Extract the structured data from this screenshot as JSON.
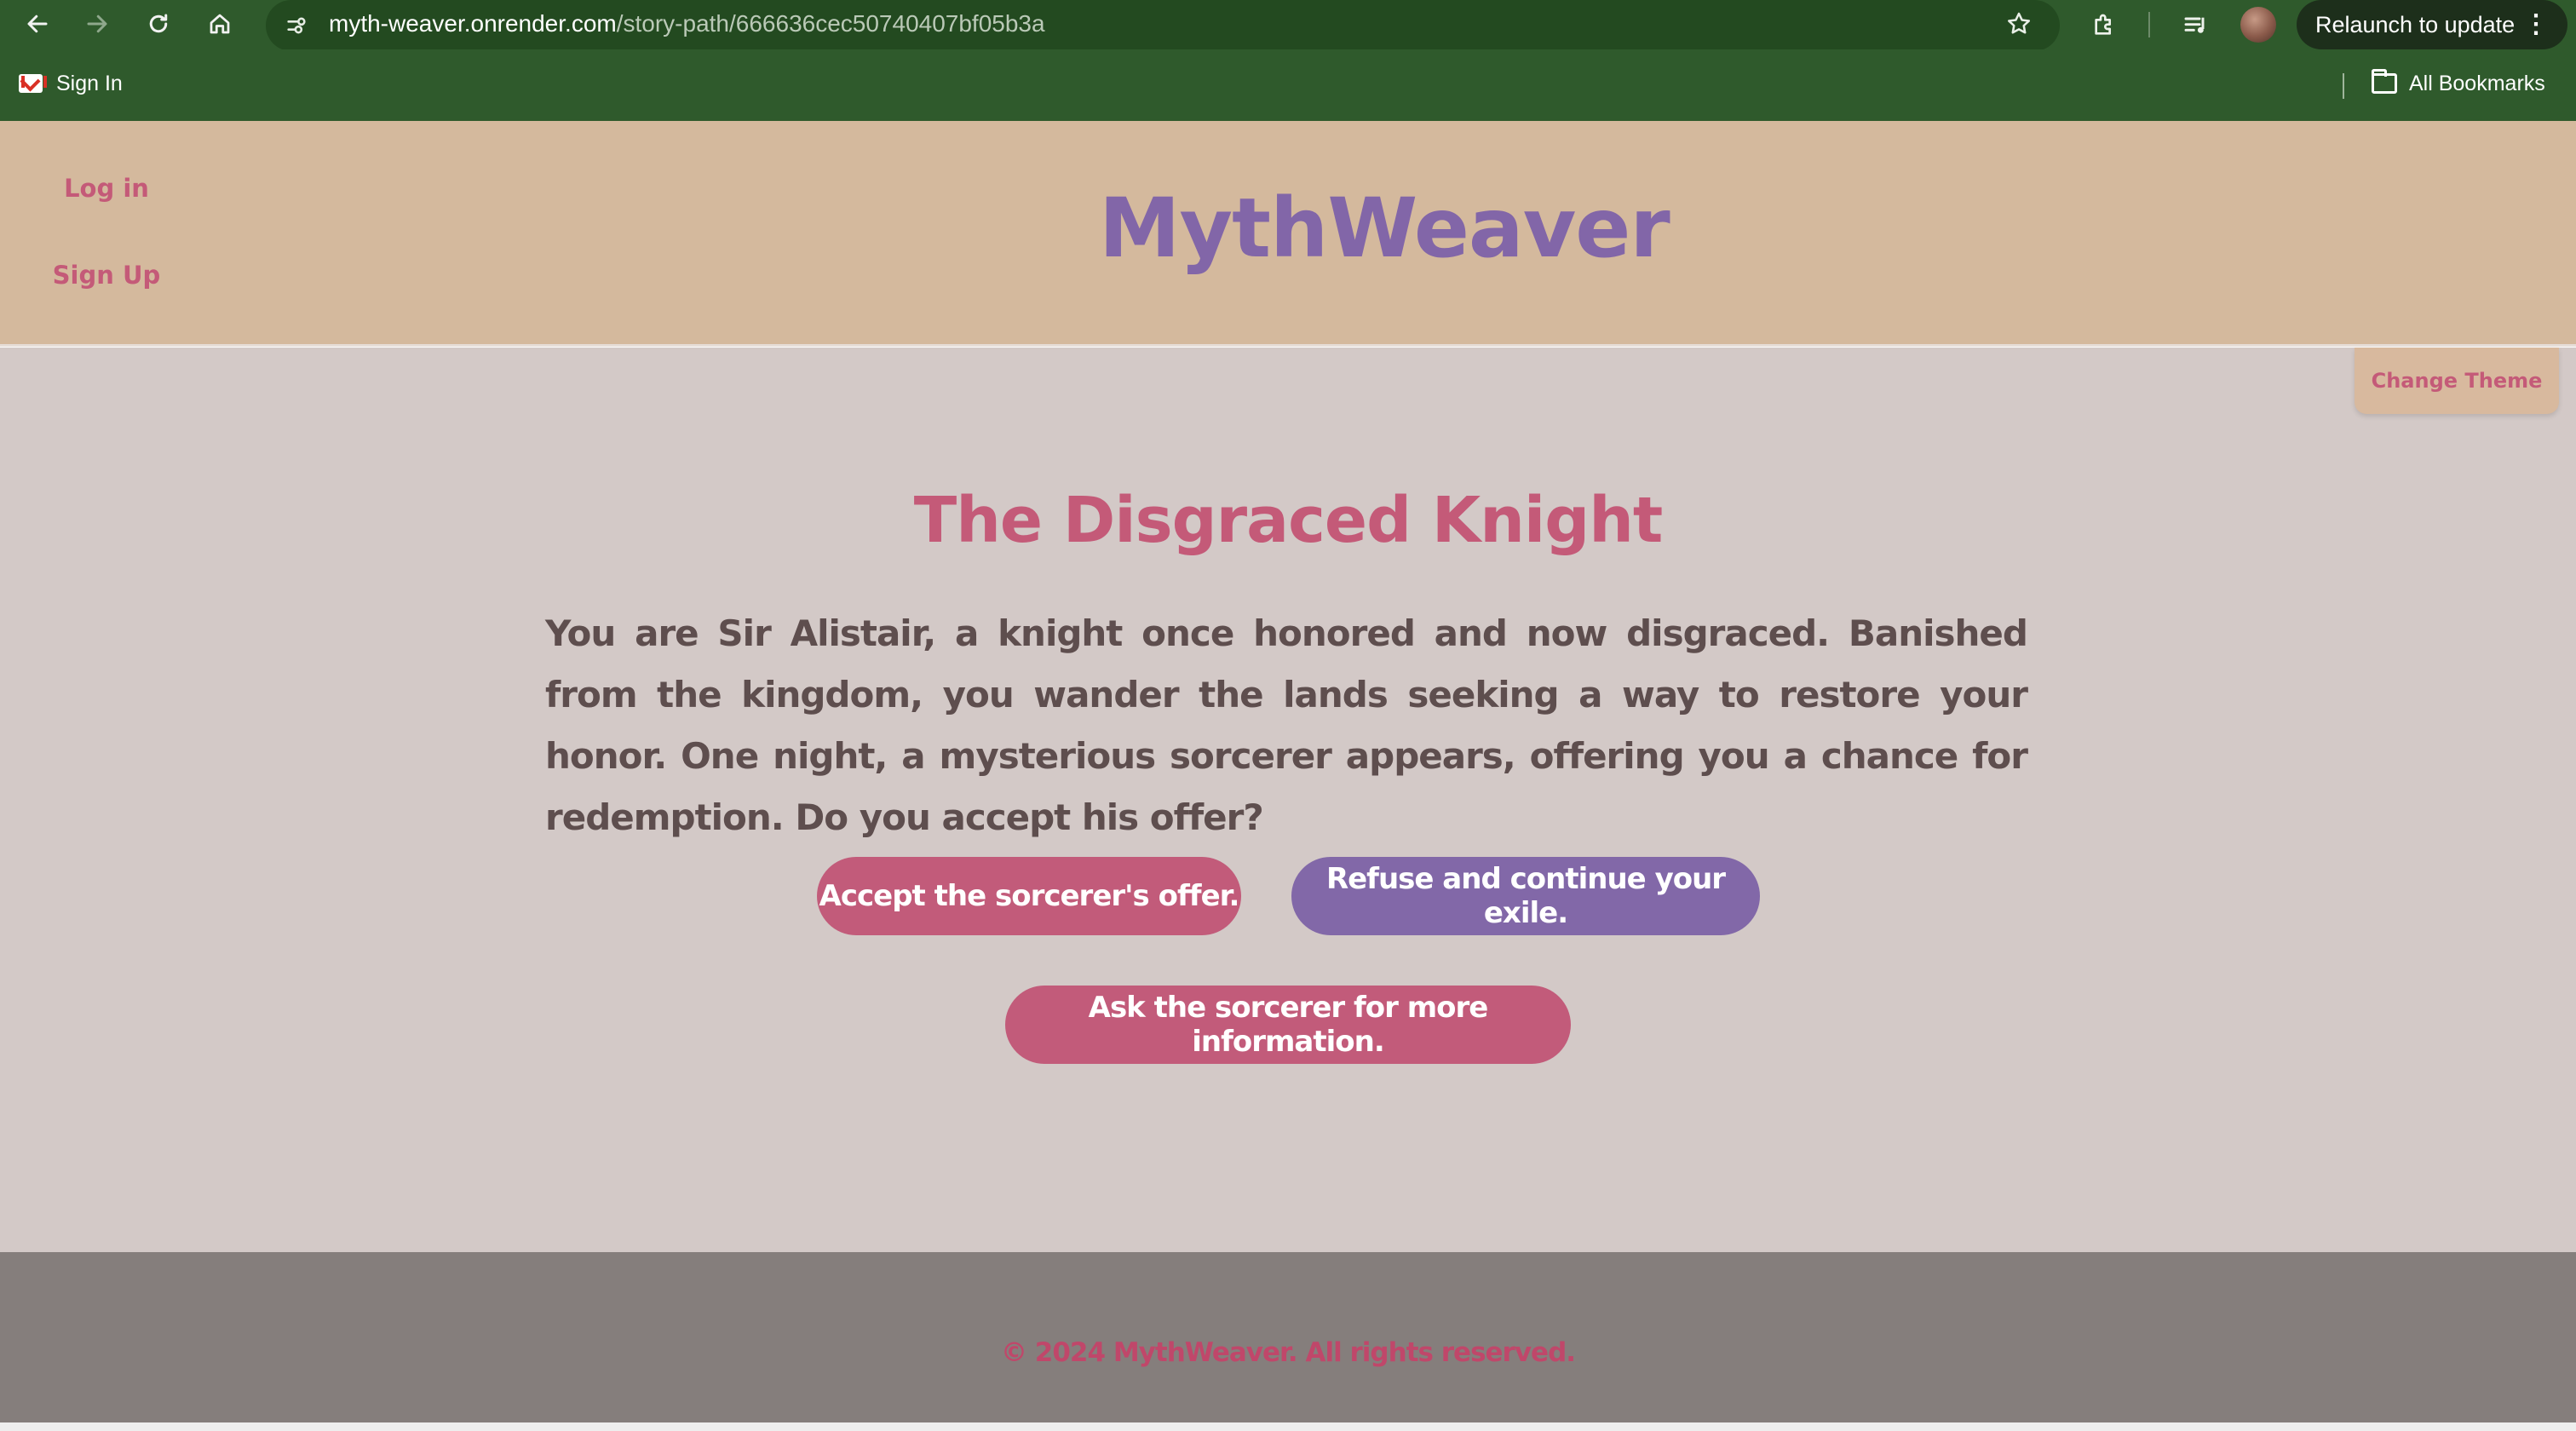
{
  "browser": {
    "url_host": "myth-weaver.onrender.com",
    "url_path": "/story-path/666636cec50740407bf05b3a",
    "relaunch_label": "Relaunch to update",
    "bookmarks": {
      "signin_label": "Sign In",
      "all_bookmarks_label": "All Bookmarks"
    },
    "icons": [
      "back-icon",
      "forward-icon",
      "reload-icon",
      "home-icon",
      "site-info-icon",
      "star-icon",
      "extensions-icon",
      "media-icon",
      "profile-avatar",
      "more-icon",
      "gmail-icon",
      "folder-icon"
    ]
  },
  "site": {
    "nav": {
      "login_label": "Log in",
      "signup_label": "Sign Up"
    },
    "title": "MythWeaver",
    "change_theme_label": "Change Theme"
  },
  "story": {
    "title": "The Disgraced Knight",
    "text": "You are Sir Alistair, a knight once honored and now disgraced. Banished from the kingdom, you wander the lands seeking a way to restore your honor. One night, a mysterious sorcerer appears, offering you a chance for redemption. Do you accept his offer?",
    "choices": [
      {
        "label": "Accept the sorcerer's offer.",
        "color": "#c25b7a"
      },
      {
        "label": "Refuse and continue your exile.",
        "color": "#8268a8"
      },
      {
        "label": "Ask the sorcerer for more information.",
        "color": "#c25b7a"
      }
    ]
  },
  "footer": {
    "text": "© 2024 MythWeaver. All rights reserved."
  },
  "colors": {
    "chrome_green": "#2f5a2c",
    "header_tan": "#d4b99d",
    "main_bg": "#d3c9c7",
    "accent_pink": "#c45a78",
    "accent_purple": "#8266a8",
    "footer_gray": "#857e7c"
  }
}
